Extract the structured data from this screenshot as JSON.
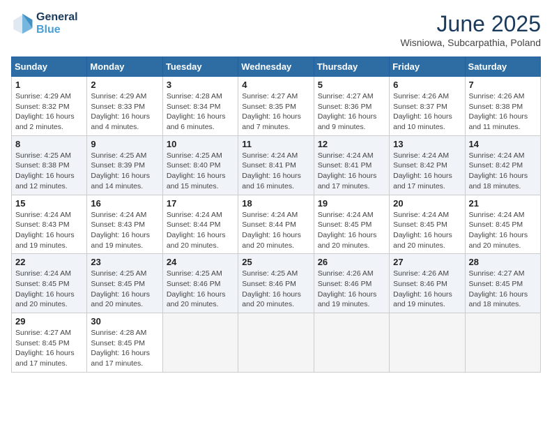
{
  "logo": {
    "line1": "General",
    "line2": "Blue"
  },
  "title": "June 2025",
  "subtitle": "Wisniowa, Subcarpathia, Poland",
  "days_header": [
    "Sunday",
    "Monday",
    "Tuesday",
    "Wednesday",
    "Thursday",
    "Friday",
    "Saturday"
  ],
  "weeks": [
    [
      {
        "num": "1",
        "info": "Sunrise: 4:29 AM\nSunset: 8:32 PM\nDaylight: 16 hours\nand 2 minutes."
      },
      {
        "num": "2",
        "info": "Sunrise: 4:29 AM\nSunset: 8:33 PM\nDaylight: 16 hours\nand 4 minutes."
      },
      {
        "num": "3",
        "info": "Sunrise: 4:28 AM\nSunset: 8:34 PM\nDaylight: 16 hours\nand 6 minutes."
      },
      {
        "num": "4",
        "info": "Sunrise: 4:27 AM\nSunset: 8:35 PM\nDaylight: 16 hours\nand 7 minutes."
      },
      {
        "num": "5",
        "info": "Sunrise: 4:27 AM\nSunset: 8:36 PM\nDaylight: 16 hours\nand 9 minutes."
      },
      {
        "num": "6",
        "info": "Sunrise: 4:26 AM\nSunset: 8:37 PM\nDaylight: 16 hours\nand 10 minutes."
      },
      {
        "num": "7",
        "info": "Sunrise: 4:26 AM\nSunset: 8:38 PM\nDaylight: 16 hours\nand 11 minutes."
      }
    ],
    [
      {
        "num": "8",
        "info": "Sunrise: 4:25 AM\nSunset: 8:38 PM\nDaylight: 16 hours\nand 12 minutes."
      },
      {
        "num": "9",
        "info": "Sunrise: 4:25 AM\nSunset: 8:39 PM\nDaylight: 16 hours\nand 14 minutes."
      },
      {
        "num": "10",
        "info": "Sunrise: 4:25 AM\nSunset: 8:40 PM\nDaylight: 16 hours\nand 15 minutes."
      },
      {
        "num": "11",
        "info": "Sunrise: 4:24 AM\nSunset: 8:41 PM\nDaylight: 16 hours\nand 16 minutes."
      },
      {
        "num": "12",
        "info": "Sunrise: 4:24 AM\nSunset: 8:41 PM\nDaylight: 16 hours\nand 17 minutes."
      },
      {
        "num": "13",
        "info": "Sunrise: 4:24 AM\nSunset: 8:42 PM\nDaylight: 16 hours\nand 17 minutes."
      },
      {
        "num": "14",
        "info": "Sunrise: 4:24 AM\nSunset: 8:42 PM\nDaylight: 16 hours\nand 18 minutes."
      }
    ],
    [
      {
        "num": "15",
        "info": "Sunrise: 4:24 AM\nSunset: 8:43 PM\nDaylight: 16 hours\nand 19 minutes."
      },
      {
        "num": "16",
        "info": "Sunrise: 4:24 AM\nSunset: 8:43 PM\nDaylight: 16 hours\nand 19 minutes."
      },
      {
        "num": "17",
        "info": "Sunrise: 4:24 AM\nSunset: 8:44 PM\nDaylight: 16 hours\nand 20 minutes."
      },
      {
        "num": "18",
        "info": "Sunrise: 4:24 AM\nSunset: 8:44 PM\nDaylight: 16 hours\nand 20 minutes."
      },
      {
        "num": "19",
        "info": "Sunrise: 4:24 AM\nSunset: 8:45 PM\nDaylight: 16 hours\nand 20 minutes."
      },
      {
        "num": "20",
        "info": "Sunrise: 4:24 AM\nSunset: 8:45 PM\nDaylight: 16 hours\nand 20 minutes."
      },
      {
        "num": "21",
        "info": "Sunrise: 4:24 AM\nSunset: 8:45 PM\nDaylight: 16 hours\nand 20 minutes."
      }
    ],
    [
      {
        "num": "22",
        "info": "Sunrise: 4:24 AM\nSunset: 8:45 PM\nDaylight: 16 hours\nand 20 minutes."
      },
      {
        "num": "23",
        "info": "Sunrise: 4:25 AM\nSunset: 8:45 PM\nDaylight: 16 hours\nand 20 minutes."
      },
      {
        "num": "24",
        "info": "Sunrise: 4:25 AM\nSunset: 8:46 PM\nDaylight: 16 hours\nand 20 minutes."
      },
      {
        "num": "25",
        "info": "Sunrise: 4:25 AM\nSunset: 8:46 PM\nDaylight: 16 hours\nand 20 minutes."
      },
      {
        "num": "26",
        "info": "Sunrise: 4:26 AM\nSunset: 8:46 PM\nDaylight: 16 hours\nand 19 minutes."
      },
      {
        "num": "27",
        "info": "Sunrise: 4:26 AM\nSunset: 8:46 PM\nDaylight: 16 hours\nand 19 minutes."
      },
      {
        "num": "28",
        "info": "Sunrise: 4:27 AM\nSunset: 8:45 PM\nDaylight: 16 hours\nand 18 minutes."
      }
    ],
    [
      {
        "num": "29",
        "info": "Sunrise: 4:27 AM\nSunset: 8:45 PM\nDaylight: 16 hours\nand 17 minutes."
      },
      {
        "num": "30",
        "info": "Sunrise: 4:28 AM\nSunset: 8:45 PM\nDaylight: 16 hours\nand 17 minutes."
      },
      null,
      null,
      null,
      null,
      null
    ]
  ]
}
